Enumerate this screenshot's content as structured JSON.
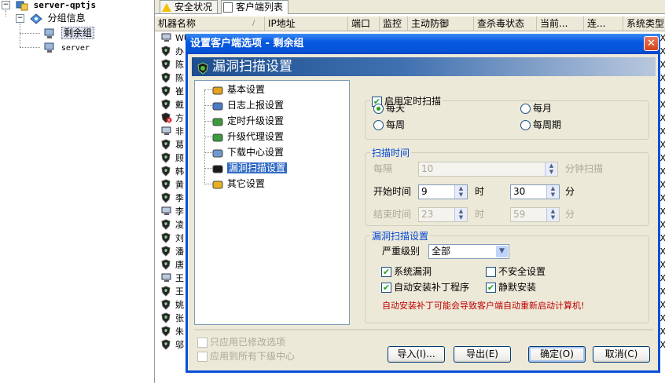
{
  "tree": {
    "root": "server-qptjs",
    "group": "分组信息",
    "selected": "剩余组",
    "child": "server"
  },
  "tabs": [
    "安全状况",
    "客户端列表"
  ],
  "columns": [
    "机器名称",
    "IP地址",
    "端口",
    "监控",
    "主动防御",
    "查杀毒状态",
    "当前...",
    "连...",
    "系统类型"
  ],
  "rows": [
    {
      "text": "WU",
      "icon": "computer-icon"
    },
    {
      "text": "办",
      "icon": "shield-icon"
    },
    {
      "text": "陈",
      "icon": "shield-icon"
    },
    {
      "text": "陈",
      "icon": "shield-icon"
    },
    {
      "text": "崔",
      "icon": "shield-icon"
    },
    {
      "text": "戴",
      "icon": "shield-icon"
    },
    {
      "text": "方",
      "icon": "shield-alert-icon"
    },
    {
      "text": "非",
      "icon": "computer-icon"
    },
    {
      "text": "葛",
      "icon": "shield-icon"
    },
    {
      "text": "顾",
      "icon": "shield-icon"
    },
    {
      "text": "韩",
      "icon": "shield-icon"
    },
    {
      "text": "黄",
      "icon": "shield-icon"
    },
    {
      "text": "季",
      "icon": "shield-icon"
    },
    {
      "text": "李",
      "icon": "computer-icon"
    },
    {
      "text": "凌",
      "icon": "shield-icon"
    },
    {
      "text": "刘",
      "icon": "shield-icon"
    },
    {
      "text": "潘",
      "icon": "shield-icon"
    },
    {
      "text": "唐",
      "icon": "shield-icon"
    },
    {
      "text": "王",
      "icon": "computer-icon"
    },
    {
      "text": "王",
      "icon": "shield-icon"
    },
    {
      "text": "姚",
      "icon": "shield-icon"
    },
    {
      "text": "张",
      "icon": "shield-icon"
    },
    {
      "text": "朱",
      "icon": "shield-icon"
    },
    {
      "text": "邬",
      "icon": "shield-icon"
    }
  ],
  "row_suffix": "X",
  "dialog": {
    "title": "设置客户端选项 - 剩余组",
    "close_glyph": "✕",
    "banner": "漏洞扫描设置",
    "nav": [
      {
        "label": "基本设置",
        "icon": "folder-gear-icon"
      },
      {
        "label": "日志上报设置",
        "icon": "log-icon"
      },
      {
        "label": "定时升级设置",
        "icon": "upgrade-icon"
      },
      {
        "label": "升级代理设置",
        "icon": "proxy-icon"
      },
      {
        "label": "下载中心设置",
        "icon": "download-icon"
      },
      {
        "label": "漏洞扫描设置",
        "icon": "shield-scan-icon"
      },
      {
        "label": "其它设置",
        "icon": "folder-icon"
      }
    ],
    "schedule": {
      "legend": "启用定时扫描",
      "daily": "每天",
      "monthly": "每月",
      "weekly": "每周",
      "monthly_cycle": "每周期"
    },
    "scan_time": {
      "legend": "扫描时间",
      "interval_label": "每隔",
      "interval_value": "10",
      "interval_unit": "分钟扫描",
      "start_label": "开始时间",
      "start_hour": "9",
      "hour_unit": "时",
      "start_minute": "30",
      "minute_unit": "分",
      "end_label": "结束时间",
      "end_hour": "23",
      "end_minute": "59"
    },
    "vuln": {
      "legend": "漏洞扫描设置",
      "severity_label": "严重级别",
      "severity_value": "全部",
      "system_vuln": "系统漏洞",
      "unsafe_settings": "不安全设置",
      "auto_install": "自动安装补丁程序",
      "silent_install": "静默安装",
      "warning": "自动安装补丁可能会导致客户端自动重新启动计算机!"
    },
    "only_modified": "只应用已修改选项",
    "apply_children": "应用到所有下级中心",
    "buttons": {
      "import": "导入(I)...",
      "export": "导出(E)",
      "ok": "确定(O)",
      "cancel": "取消(C)"
    }
  },
  "colors": {
    "title_bar": "#0553d8",
    "legend": "#0046d5",
    "warning": "#c00000",
    "selection": "#316ac5"
  }
}
